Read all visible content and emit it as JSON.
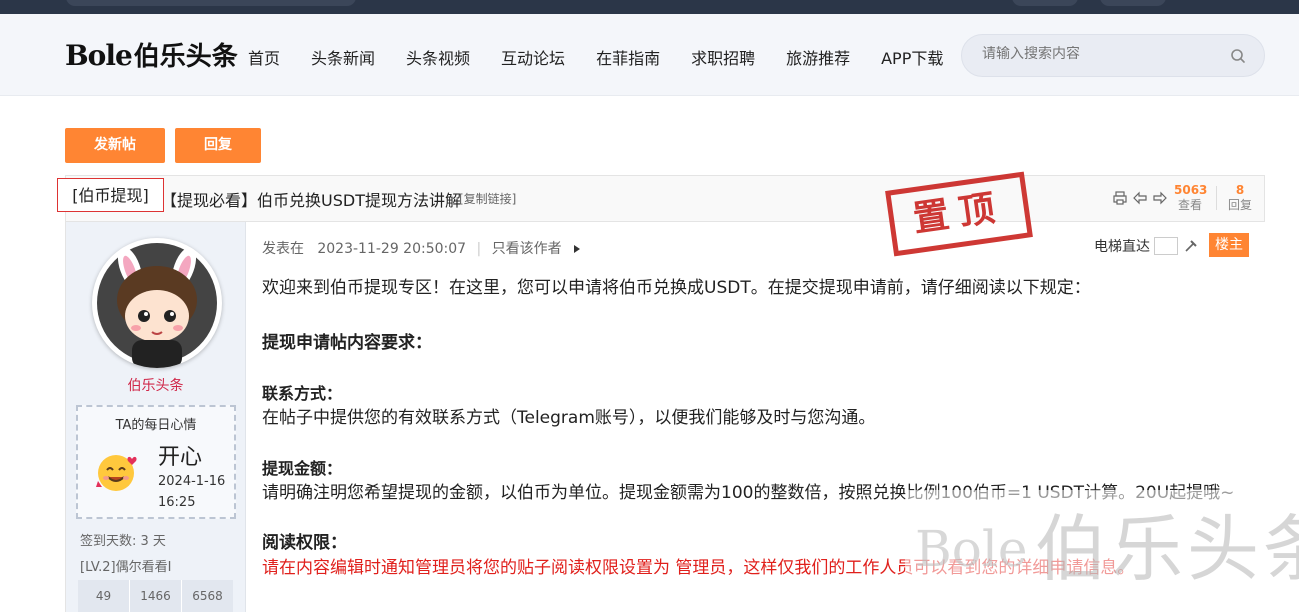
{
  "header": {
    "logo_en": "Bole",
    "logo_cn": "伯乐头条",
    "nav": [
      "首页",
      "头条新闻",
      "头条视频",
      "互动论坛",
      "在菲指南",
      "求职招聘",
      "旅游推荐",
      "APP下载"
    ],
    "search_placeholder": "请输入搜索内容"
  },
  "actions": {
    "new_post": "发新帖",
    "reply": "回复"
  },
  "thread": {
    "category": "[伯币提现]",
    "title": "【提现必看】伯币兑换USDT提现方法讲解",
    "copy_link": "[复制链接]",
    "views_num": "5063",
    "views_label": "查看",
    "replies_num": "8",
    "replies_label": "回复",
    "stamp": "置顶"
  },
  "author": {
    "name": "伯乐头条",
    "mood_title": "TA的每日心情",
    "mood_word": "开心",
    "mood_date": "2024-1-16",
    "mood_time": "16:25",
    "sign_days": "签到天数: 3 天",
    "level": "[LV.2]偶尔看看I",
    "stats": [
      "49",
      "1466",
      "6568"
    ]
  },
  "post": {
    "posted_label": "发表在",
    "posted_time": "2023-11-29 20:50:07",
    "only_author": "只看该作者",
    "floor_jump": "电梯直达",
    "floor_tag": "楼主",
    "intro": "欢迎来到伯币提现专区！在这里，您可以申请将伯币兑换成USDT。在提交提现申请前，请仔细阅读以下规定：",
    "req_title": "提现申请帖内容要求：",
    "contact_title": "联系方式：",
    "contact_text": "在帖子中提供您的有效联系方式（Telegram账号），以便我们能够及时与您沟通。",
    "amount_title": "提现金额：",
    "amount_text": "请明确注明您希望提现的金额，以伯币为单位。提现金额需为100的整数倍，按照兑换比例100伯币=1 USDT计算。20U起提哦~",
    "perm_title": "阅读权限：",
    "perm_text": "请在内容编辑时通知管理员将您的贴子阅读权限设置为 管理员，这样仅我们的工作人员可以看到您的详细申请信息。"
  },
  "colors": {
    "accent": "#ff8533",
    "header_dark": "#2b3648",
    "warning_red": "#e0201c",
    "author_pink": "#d0284a"
  }
}
